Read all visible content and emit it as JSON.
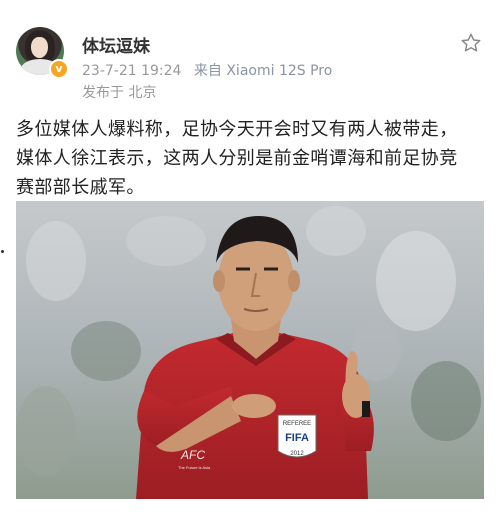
{
  "post": {
    "author": "体坛逗妹",
    "verified_badge": "v",
    "date": "23-7-21 19:24",
    "source": "来自 Xiaomi 12S Pro",
    "location": "发布于 北京",
    "text_lines": [
      "多位媒体人爆料称，足协今天开会时又有两人被带走，",
      "媒体人徐江表示，这两人分别是前金哨谭海和前足协竞",
      "赛部部长戚军。"
    ],
    "favorite_icon": "star-icon"
  },
  "photo": {
    "badge_top": "REFEREE",
    "badge_main": "FIFA",
    "badge_year": "2012",
    "chest_logo": "AFC",
    "chest_sub": "The Future is Asia",
    "colors": {
      "shirt": "#b8242a",
      "background": "#c0c4c8"
    }
  }
}
